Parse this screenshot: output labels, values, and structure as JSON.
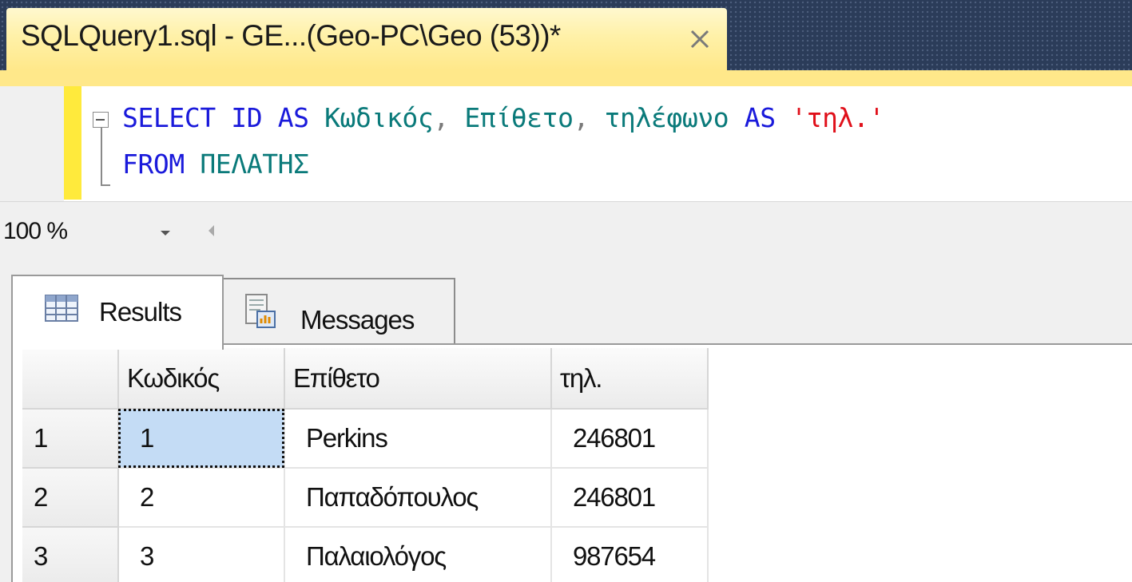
{
  "document_tab": {
    "title": "SQLQuery1.sql - GE...(Geo-PC\\Geo (53))*"
  },
  "editor": {
    "line1": {
      "kw_select": "SELECT",
      "col_id": "ID",
      "kw_as1": "AS",
      "alias1": "Κωδικός",
      "comma1": ",",
      "col_surname": "Επίθετο",
      "comma2": ",",
      "col_phone": "τηλέφωνο",
      "kw_as2": "AS",
      "alias2": "'τηλ.'"
    },
    "line2": {
      "kw_from": "FROM",
      "table": "ΠΕΛΑΤΗΣ"
    }
  },
  "zoom": {
    "value": "100 %"
  },
  "results_tabs": [
    {
      "label": "Results",
      "icon": "grid-icon",
      "active": true
    },
    {
      "label": "Messages",
      "icon": "messages-icon",
      "active": false
    }
  ],
  "grid": {
    "columns": [
      "",
      "Κωδικός",
      "Επίθετο",
      "τηλ."
    ],
    "rows": [
      {
        "num": "1",
        "id": "1",
        "surname": "Perkins",
        "phone": "246801"
      },
      {
        "num": "2",
        "id": "2",
        "surname": "Παπαδόπουλος",
        "phone": "246801"
      },
      {
        "num": "3",
        "id": "3",
        "surname": "Παλαιολόγος",
        "phone": "987654"
      }
    ]
  },
  "colors": {
    "keyword": "#1a1adb",
    "identifier": "#0a7a7a",
    "string": "#e0101a",
    "tab_active_bg": "#ffe88a",
    "selection": "#c4dcf5",
    "tabstrip_bg": "#2b3c59"
  }
}
